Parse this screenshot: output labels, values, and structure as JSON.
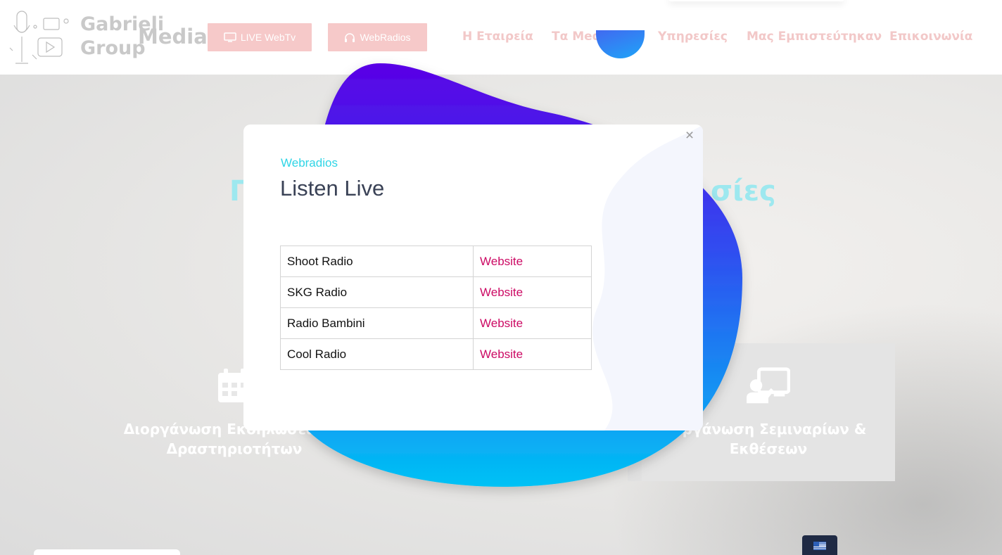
{
  "header": {
    "logo": {
      "line1": "Gabrieli",
      "line2": "Group",
      "line3": "Media"
    },
    "buttons": {
      "live_webtv": "LIVE WebTv",
      "webradios": "WebRadios"
    },
    "nav": [
      "Η Εταιρεία",
      "Τα Media",
      "Υπηρεσίες",
      "Μας Εμπιστεύτηκαν",
      "Επικοινωνία"
    ]
  },
  "hero": {
    "title_left": "Π",
    "title_right": "σίες",
    "cards": [
      {
        "icon": "calendar-icon",
        "title": "Διοργάνωση Εκδηλώσεων & Δραστηριοτήτων"
      },
      {
        "icon": "presentation-icon",
        "title": "Οργάνωση Σεμιναρίων & Εκθέσεων"
      }
    ]
  },
  "language": {
    "icon": "greek-flag-icon"
  },
  "modal": {
    "subtitle": "Webradios",
    "title": "Listen Live",
    "close": "×",
    "stations": [
      {
        "name": "Shoot Radio",
        "link": "Website"
      },
      {
        "name": "SKG Radio",
        "link": "Website"
      },
      {
        "name": "Radio Bambini",
        "link": "Website"
      },
      {
        "name": "Cool Radio",
        "link": "Website"
      }
    ]
  },
  "colors": {
    "accent_cyan": "#2fd5e6",
    "link_pink": "#cc0a64",
    "blob_top": "#5a00e6",
    "blob_bottom": "#00c2f5",
    "header_button": "#f6c9c9"
  }
}
